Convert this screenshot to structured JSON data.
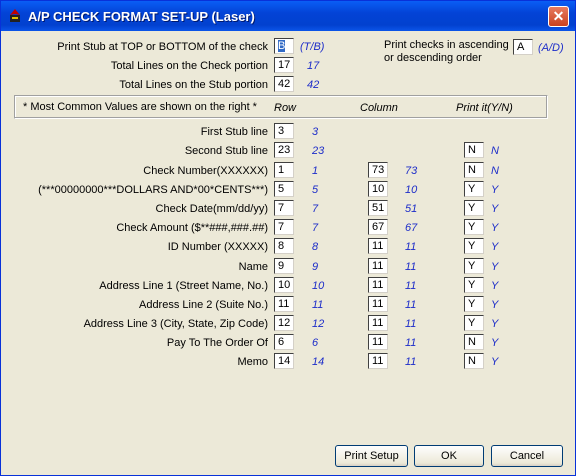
{
  "window": {
    "title": "A/P CHECK FORMAT SET-UP (Laser)"
  },
  "top": {
    "stub_pos": {
      "label": "Print Stub at TOP or BOTTOM of the check",
      "value": "B",
      "hint": "(T/B)"
    },
    "check_lines": {
      "label": "Total Lines on the Check portion",
      "value": "17",
      "hint": "17"
    },
    "stub_lines": {
      "label": "Total Lines on the Stub portion",
      "value": "42",
      "hint": "42"
    },
    "order": {
      "label1": "Print checks in ascending",
      "label2": "or descending order",
      "value": "A",
      "hint": "(A/D)"
    }
  },
  "header": {
    "note": "* Most Common Values are shown on the right *",
    "row": "Row",
    "column": "Column",
    "print_it": "Print it(Y/N)"
  },
  "rows": [
    {
      "label": "First Stub line",
      "row": "3",
      "row_hint": "3"
    },
    {
      "label": "Second Stub line",
      "row": "23",
      "row_hint": "23",
      "print": "N",
      "print_hint": "N"
    },
    {
      "label": "Check Number(XXXXXX)",
      "row": "1",
      "row_hint": "1",
      "col": "73",
      "col_hint": "73",
      "print": "N",
      "print_hint": "N"
    },
    {
      "label": "(***00000000***DOLLARS AND*00*CENTS***)",
      "row": "5",
      "row_hint": "5",
      "col": "10",
      "col_hint": "10",
      "print": "Y",
      "print_hint": "Y"
    },
    {
      "label": "Check Date(mm/dd/yy)",
      "row": "7",
      "row_hint": "7",
      "col": "51",
      "col_hint": "51",
      "print": "Y",
      "print_hint": "Y"
    },
    {
      "label": "Check Amount ($**###,###.##)",
      "row": "7",
      "row_hint": "7",
      "col": "67",
      "col_hint": "67",
      "print": "Y",
      "print_hint": "Y"
    },
    {
      "label": "ID Number (XXXXX)",
      "row": "8",
      "row_hint": "8",
      "col": "11",
      "col_hint": "11",
      "print": "Y",
      "print_hint": "Y"
    },
    {
      "label": "Name",
      "row": "9",
      "row_hint": "9",
      "col": "11",
      "col_hint": "11",
      "print": "Y",
      "print_hint": "Y"
    },
    {
      "label": "Address Line 1 (Street Name, No.)",
      "row": "10",
      "row_hint": "10",
      "col": "11",
      "col_hint": "11",
      "print": "Y",
      "print_hint": "Y"
    },
    {
      "label": "Address Line 2 (Suite No.)",
      "row": "11",
      "row_hint": "11",
      "col": "11",
      "col_hint": "11",
      "print": "Y",
      "print_hint": "Y"
    },
    {
      "label": "Address Line 3 (City, State, Zip Code)",
      "row": "12",
      "row_hint": "12",
      "col": "11",
      "col_hint": "11",
      "print": "Y",
      "print_hint": "Y"
    },
    {
      "label": "Pay To The Order Of",
      "row": "6",
      "row_hint": "6",
      "col": "11",
      "col_hint": "11",
      "print": "N",
      "print_hint": "Y"
    },
    {
      "label": "Memo",
      "row": "14",
      "row_hint": "14",
      "col": "11",
      "col_hint": "11",
      "print": "N",
      "print_hint": "Y"
    }
  ],
  "buttons": {
    "print_setup": "Print Setup",
    "ok": "OK",
    "cancel": "Cancel"
  },
  "icons": {
    "app": "app-icon",
    "close": "close-icon"
  }
}
